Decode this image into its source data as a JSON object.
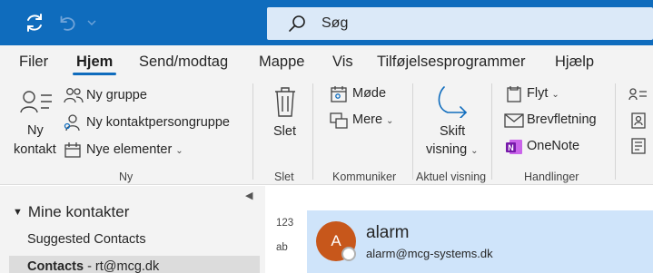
{
  "search": {
    "placeholder": "Søg"
  },
  "tabs": [
    {
      "label": "Filer"
    },
    {
      "label": "Hjem"
    },
    {
      "label": "Send/modtag"
    },
    {
      "label": "Mappe"
    },
    {
      "label": "Vis"
    },
    {
      "label": "Tilføjelsesprogrammer"
    },
    {
      "label": "Hjælp"
    }
  ],
  "ribbon": {
    "ny": {
      "new_contact_line1": "Ny",
      "new_contact_line2": "kontakt",
      "new_group": "Ny gruppe",
      "new_contact_group": "Ny kontaktpersongruppe",
      "new_items": "Nye elementer",
      "group_label": "Ny"
    },
    "slet": {
      "delete": "Slet",
      "group_label": "Slet"
    },
    "kommuniker": {
      "meeting": "Møde",
      "more": "Mere",
      "group_label": "Kommuniker"
    },
    "view": {
      "change_view_line1": "Skift",
      "change_view_line2": "visning",
      "group_label": "Aktuel visning"
    },
    "handlinger": {
      "move": "Flyt",
      "mail_merge": "Brevfletning",
      "onenote": "OneNote",
      "group_label": "Handlinger"
    }
  },
  "left_pane": {
    "root": "Mine kontakter",
    "folders": [
      {
        "label": "Suggested Contacts"
      },
      {
        "label": "Contacts",
        "account": " - rt@mcg.dk"
      }
    ]
  },
  "content": {
    "index": [
      "123",
      "ab"
    ],
    "contact": {
      "initial": "A",
      "name": "alarm",
      "email": "alarm@mcg-systems.dk"
    }
  },
  "colors": {
    "accent": "#0f6cbd",
    "avatar": "#c7571b",
    "selected_card": "#cfe4fa",
    "onenote": "#7719aa"
  }
}
